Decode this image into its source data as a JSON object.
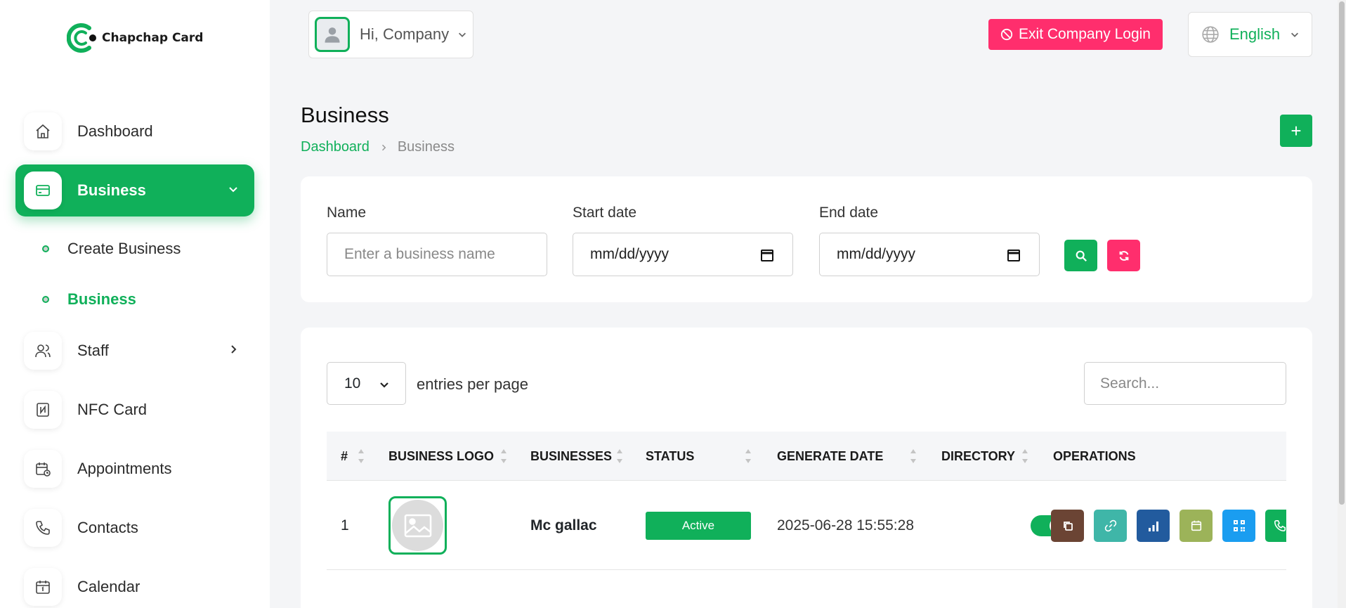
{
  "brand": {
    "name": "Chapchap Card"
  },
  "sidebar": {
    "items": [
      {
        "label": "Dashboard",
        "icon": "home-icon"
      },
      {
        "label": "Business",
        "icon": "card-icon",
        "active": true
      },
      {
        "label": "Staff",
        "icon": "users-icon"
      },
      {
        "label": "NFC Card",
        "icon": "nfc-icon"
      },
      {
        "label": "Appointments",
        "icon": "calendar-clock-icon"
      },
      {
        "label": "Contacts",
        "icon": "phone-icon"
      },
      {
        "label": "Calendar",
        "icon": "calendar-icon"
      }
    ],
    "sub_items": [
      {
        "label": "Create Business"
      },
      {
        "label": "Business",
        "active": true
      }
    ]
  },
  "header": {
    "greeting": "Hi, Company",
    "exit_label": "Exit Company Login",
    "language": "English"
  },
  "page": {
    "title": "Business",
    "breadcrumb": {
      "root": "Dashboard",
      "current": "Business"
    },
    "add_label": "+"
  },
  "filters": {
    "name_label": "Name",
    "name_placeholder": "Enter a business name",
    "start_label": "Start date",
    "start_value": "mm/dd/yyyy",
    "end_label": "End date",
    "end_value": "mm/dd/yyyy"
  },
  "table": {
    "per_page": "10",
    "per_page_label": "entries per page",
    "search_placeholder": "Search...",
    "columns": [
      "#",
      "BUSINESS LOGO",
      "BUSINESSES",
      "STATUS",
      "GENERATE DATE",
      "DIRECTORY",
      "OPERATIONS"
    ],
    "rows": [
      {
        "index": "1",
        "name": "Mc gallac",
        "status": "Active",
        "date": "2025-06-28 15:55:28",
        "directory": true
      }
    ],
    "operations": [
      {
        "icon": "copy-icon",
        "color": "#6b4434"
      },
      {
        "icon": "link-icon",
        "color": "#3fb6a8"
      },
      {
        "icon": "stats-icon",
        "color": "#225b9e"
      },
      {
        "icon": "calendar-icon",
        "color": "#9cb359"
      },
      {
        "icon": "qrcode-icon",
        "color": "#1a9df0"
      },
      {
        "icon": "phone-icon",
        "color": "#10b05a"
      }
    ]
  },
  "colors": {
    "accent": "#10b05a",
    "danger": "#ff2e6d"
  }
}
